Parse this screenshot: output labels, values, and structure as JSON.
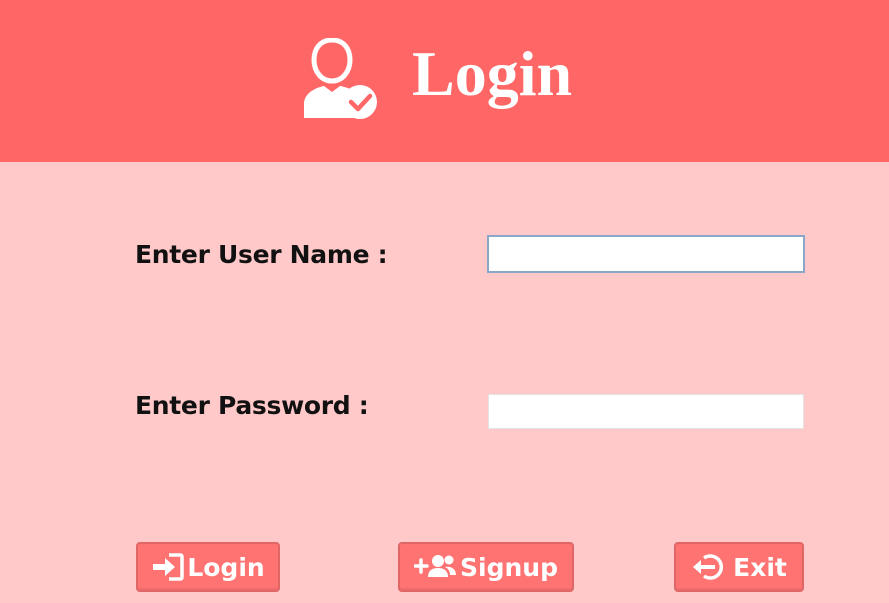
{
  "header": {
    "title": "Login",
    "icon": "user-check-icon",
    "background_color": "#ff6666"
  },
  "form": {
    "username_label": "Enter User Name :",
    "username_value": "",
    "password_label": "Enter Password :",
    "password_value": ""
  },
  "buttons": {
    "login_label": "Login",
    "login_icon": "sign-in-icon",
    "signup_label": "Signup",
    "signup_icon": "user-plus-icon",
    "exit_label": "Exit",
    "exit_icon": "sign-out-icon"
  },
  "colors": {
    "body_background": "#ffc9c9",
    "button_background": "#ff7373",
    "text": "#111111"
  }
}
